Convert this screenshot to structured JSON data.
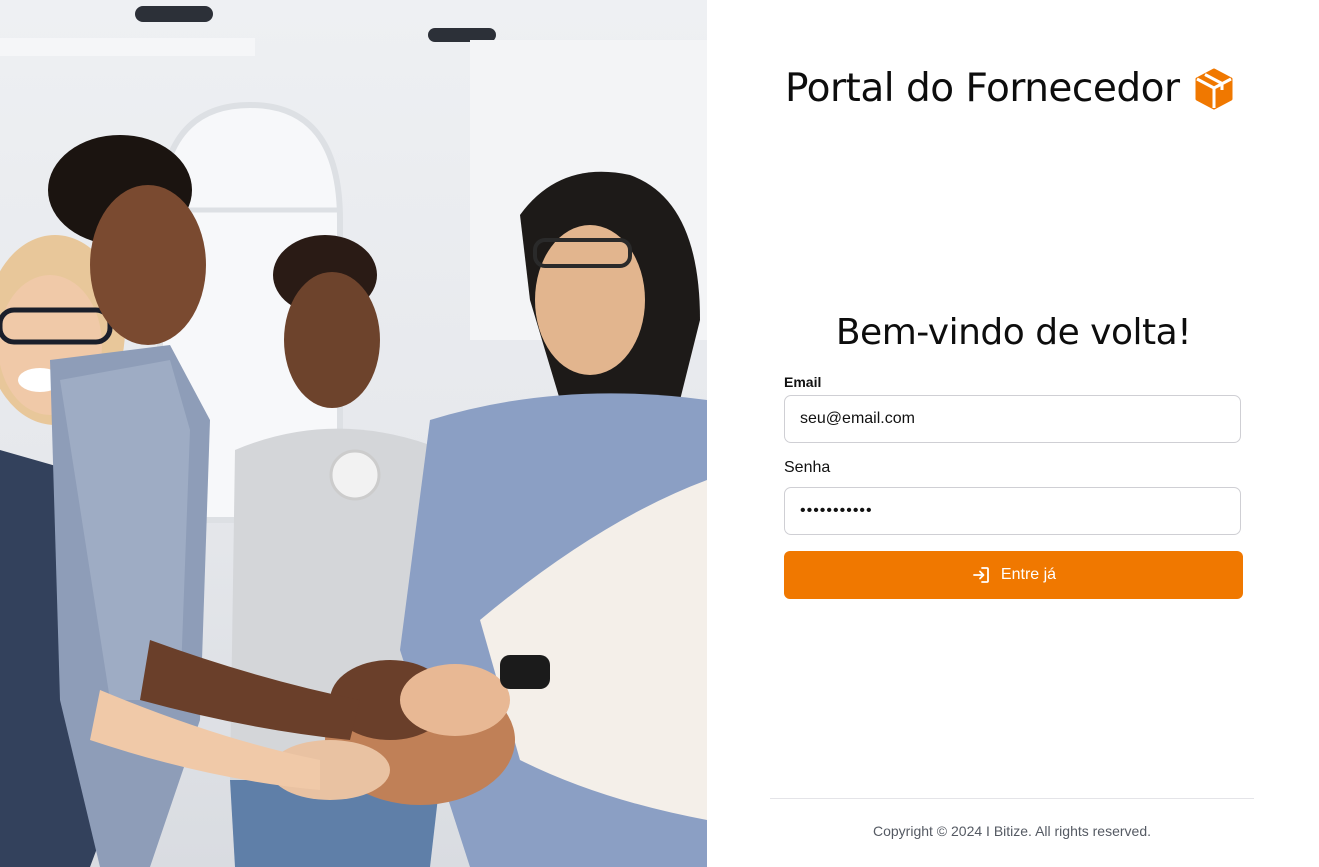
{
  "hero": {
    "description_icon": "team-photo"
  },
  "brand": {
    "title": "Portal do Fornecedor",
    "icon": "package-box-icon",
    "accent_color": "#f07800"
  },
  "login": {
    "heading": "Bem-vindo de volta!",
    "email": {
      "label": "Email",
      "value": "seu@email.com"
    },
    "password": {
      "label": "Senha",
      "value": "•••••••••••"
    },
    "submit": {
      "label": "Entre já",
      "icon": "sign-in-icon"
    }
  },
  "footer": {
    "copyright": "Copyright © 2024 I Bitize. All rights reserved."
  }
}
